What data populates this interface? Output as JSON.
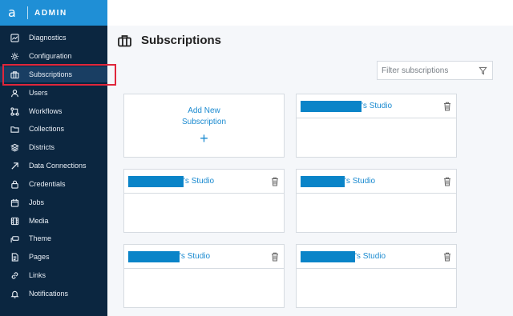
{
  "brand": {
    "logo": "a",
    "title": "ADMIN"
  },
  "sidebar": {
    "items": [
      {
        "label": "Diagnostics",
        "icon": "chart-icon"
      },
      {
        "label": "Configuration",
        "icon": "gear-icon"
      },
      {
        "label": "Subscriptions",
        "icon": "briefcase-icon",
        "active": true
      },
      {
        "label": "Users",
        "icon": "user-icon"
      },
      {
        "label": "Workflows",
        "icon": "workflow-icon"
      },
      {
        "label": "Collections",
        "icon": "folder-icon"
      },
      {
        "label": "Districts",
        "icon": "layers-icon"
      },
      {
        "label": "Data Connections",
        "icon": "arrow-up-right-icon"
      },
      {
        "label": "Credentials",
        "icon": "lock-icon"
      },
      {
        "label": "Jobs",
        "icon": "calendar-icon"
      },
      {
        "label": "Media",
        "icon": "film-icon"
      },
      {
        "label": "Theme",
        "icon": "paint-roller-icon"
      },
      {
        "label": "Pages",
        "icon": "document-icon"
      },
      {
        "label": "Links",
        "icon": "link-icon"
      },
      {
        "label": "Notifications",
        "icon": "bell-icon"
      }
    ]
  },
  "main": {
    "title": "Subscriptions",
    "filter": {
      "placeholder": "Filter subscriptions"
    },
    "add_card": {
      "line1": "Add New",
      "line2": "Subscription",
      "plus": "+"
    },
    "cards": [
      {
        "name_suffix": "'s Studio"
      },
      {
        "name_suffix": "'s Studio"
      },
      {
        "name_suffix": "'s Studio"
      },
      {
        "name_suffix": "'s Studio"
      },
      {
        "name_suffix": "'s Studio"
      }
    ]
  },
  "colors": {
    "sidebar": "#0b2640",
    "brand": "#1f8fd6",
    "accent": "#1a8ad0",
    "highlight": "#e0263b",
    "redaction": "#0a84c8"
  }
}
